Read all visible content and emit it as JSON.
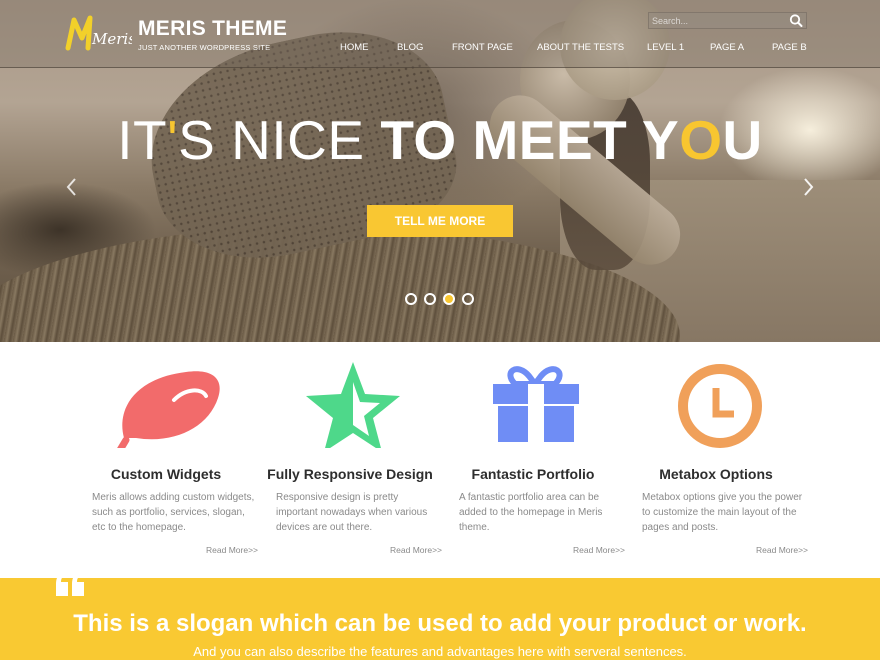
{
  "site": {
    "logo_script": "Meris",
    "title": "MERIS THEME",
    "tagline": "JUST ANOTHER WORDPRESS SITE"
  },
  "search": {
    "placeholder": "Search..."
  },
  "nav": {
    "items": [
      {
        "label": "HOME"
      },
      {
        "label": "BLOG"
      },
      {
        "label": "FRONT PAGE"
      },
      {
        "label": "ABOUT THE TESTS"
      },
      {
        "label": "LEVEL 1"
      },
      {
        "label": "PAGE A"
      },
      {
        "label": "PAGE B"
      }
    ]
  },
  "hero": {
    "headline_part1": "IT",
    "headline_accent1": "'",
    "headline_part2": "S NICE ",
    "headline_bold1": "TO MEET Y",
    "headline_accent2": "O",
    "headline_bold2": "U",
    "button_label": "TELL ME MORE",
    "slides_count": 4,
    "active_slide": 3
  },
  "features": [
    {
      "icon": "leaf-icon",
      "title": "Custom Widgets",
      "desc": "Meris allows adding custom widgets, such as portfolio, services, slogan, etc to the homepage.",
      "more": "Read More>>"
    },
    {
      "icon": "star-icon",
      "title": "Fully Responsive Design",
      "desc": "Responsive design is pretty important nowadays when various devices are out there.",
      "more": "Read More>>"
    },
    {
      "icon": "gift-icon",
      "title": "Fantastic Portfolio",
      "desc": "A fantastic portfolio area can be added to the homepage in Meris theme.",
      "more": "Read More>>"
    },
    {
      "icon": "clock-icon",
      "title": "Metabox Options",
      "desc": "Metabox options give you the power to customize the main layout of the pages and posts.",
      "more": "Read More>>"
    }
  ],
  "slogan": {
    "title": "This is a slogan which can be used to add your product or work.",
    "subtitle": "And you can also describe the features and advantages here with serveral sentences."
  },
  "colors": {
    "accent": "#f9c732",
    "leaf": "#f26b6b",
    "star": "#4ed88a",
    "gift": "#6f8df5",
    "clock": "#f0a05a"
  }
}
